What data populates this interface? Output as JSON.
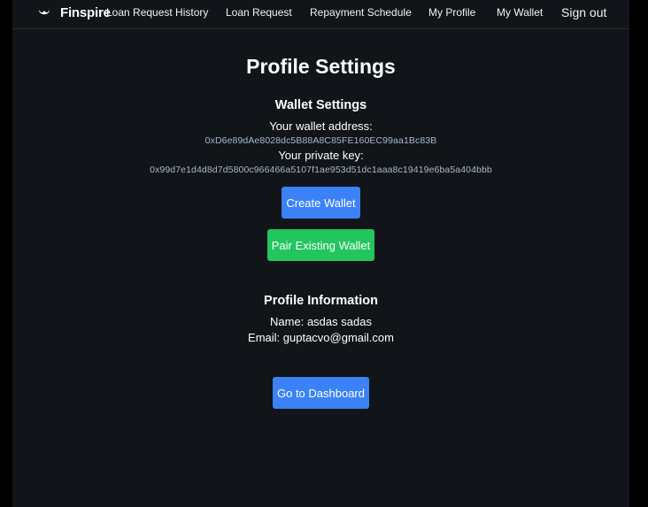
{
  "nav": {
    "brand": "Finspire",
    "links": [
      "Loan Request History",
      "Loan Request",
      "Repayment Schedule",
      "My Profile",
      "My Wallet"
    ],
    "sign_out": "Sign out"
  },
  "page": {
    "title": "Profile Settings"
  },
  "wallet": {
    "heading": "Wallet Settings",
    "address_label": "Your wallet address:",
    "address": "0xD6e89dAe8028dc5B88A8C85FE160EC99aa1Bc83B",
    "key_label": "Your private key:",
    "private_key": "0x99d7e1d4d8d7d5800c966466a5107f1ae953d51dc1aaa8c19419e6ba5a404bbb",
    "create_button": "Create Wallet",
    "pair_button": "Pair Existing Wallet"
  },
  "profile": {
    "heading": "Profile Information",
    "name": "Name: asdas sadas",
    "email": "Email: guptacvo@gmail.com"
  },
  "actions": {
    "dashboard_button": "Go to Dashboard"
  },
  "colors": {
    "background": "#111418",
    "primary_button": "#3b82f6",
    "success_button": "#22c55e",
    "mono_text": "#a8b8d0"
  }
}
